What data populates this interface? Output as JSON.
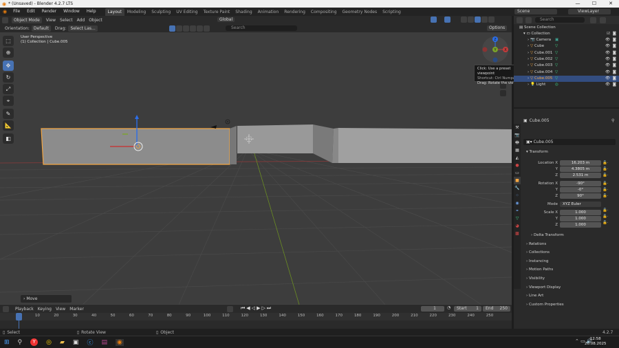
{
  "window": {
    "title": "* (Unsaved) - Blender 4.2.7 LTS",
    "controls": [
      "—",
      "☐",
      "✕"
    ]
  },
  "menu": [
    "File",
    "Edit",
    "Render",
    "Window",
    "Help"
  ],
  "workspaces": [
    "Layout",
    "Modeling",
    "Sculpting",
    "UV Editing",
    "Texture Paint",
    "Shading",
    "Animation",
    "Rendering",
    "Compositing",
    "Geometry Nodes",
    "Scripting"
  ],
  "scene": {
    "scene_label": "Scene",
    "view_layer_label": "ViewLayer"
  },
  "header": {
    "mode": "Object Mode",
    "menus": [
      "View",
      "Select",
      "Add",
      "Object"
    ],
    "transform_orient": "Global"
  },
  "header2": {
    "orientation_label": "Orientation:",
    "orientation_value": "Default",
    "drag_label": "Drag:",
    "drag_value": "Select Las...",
    "options": "Options",
    "search_placeholder": "Search"
  },
  "viewport": {
    "line1": "User Perspective",
    "line2": "(1) Collection | Cube.005",
    "operator_panel": "Move"
  },
  "tooltip": {
    "l1": "Click: Use a preset viewpoint",
    "l2": "Shortcut: Ctrl Numpad 1",
    "l3": "Drag: Rotate the view"
  },
  "gizmo": {
    "y": "Y",
    "x": "X",
    "z": "Z"
  },
  "outliner": {
    "search_placeholder": "",
    "root": "Scene Collection",
    "collection": "Collection",
    "items": [
      {
        "name": "Camera",
        "type": "camera"
      },
      {
        "name": "Cube",
        "type": "mesh"
      },
      {
        "name": "Cube.001",
        "type": "mesh"
      },
      {
        "name": "Cube.002",
        "type": "mesh"
      },
      {
        "name": "Cube.003",
        "type": "mesh"
      },
      {
        "name": "Cube.004",
        "type": "mesh"
      },
      {
        "name": "Cube.005",
        "type": "mesh",
        "selected": true
      },
      {
        "name": "Light",
        "type": "light"
      }
    ]
  },
  "properties": {
    "object_name": "Cube.005",
    "datablock": "Cube.005",
    "transform": "Transform",
    "location_label": "Location X",
    "location": [
      "16.203 m",
      "4.3805 m",
      "2.531 m"
    ],
    "rotation_label": "Rotation X",
    "rotation": [
      "-90°",
      "-0°",
      "90°"
    ],
    "mode_label": "Mode",
    "mode_value": "XYZ Euler",
    "scale_label": "Scale X",
    "scale": [
      "1.000",
      "1.000",
      "1.000"
    ],
    "axis_y": "Y",
    "axis_z": "Z",
    "sections": [
      "Delta Transform",
      "Relations",
      "Collections",
      "Instancing",
      "Motion Paths",
      "Visibility",
      "Viewport Display",
      "Line Art",
      "Custom Properties"
    ]
  },
  "timeline": {
    "menus": [
      "Playback",
      "Keying",
      "View",
      "Marker"
    ],
    "current_frame": "1",
    "start_label": "Start",
    "start": "1",
    "end_label": "End",
    "end": "250",
    "ruler": [
      "0",
      "10",
      "20",
      "30",
      "40",
      "50",
      "60",
      "70",
      "80",
      "90",
      "100",
      "110",
      "120",
      "130",
      "140",
      "150",
      "160",
      "170",
      "180",
      "190",
      "200",
      "210",
      "220",
      "230",
      "240",
      "250"
    ]
  },
  "status": {
    "select": "Select",
    "rotate": "Rotate View",
    "object": "Object",
    "version": "4.2.7"
  },
  "taskbar": {
    "time": "12:58",
    "date": "20.08.2025"
  },
  "colors": {
    "accent": "#4772b3",
    "selection_orange": "#f5a742",
    "axis_red": "#c23c3c",
    "axis_green": "#7ba32a",
    "mesh_green": "#3fd489"
  }
}
